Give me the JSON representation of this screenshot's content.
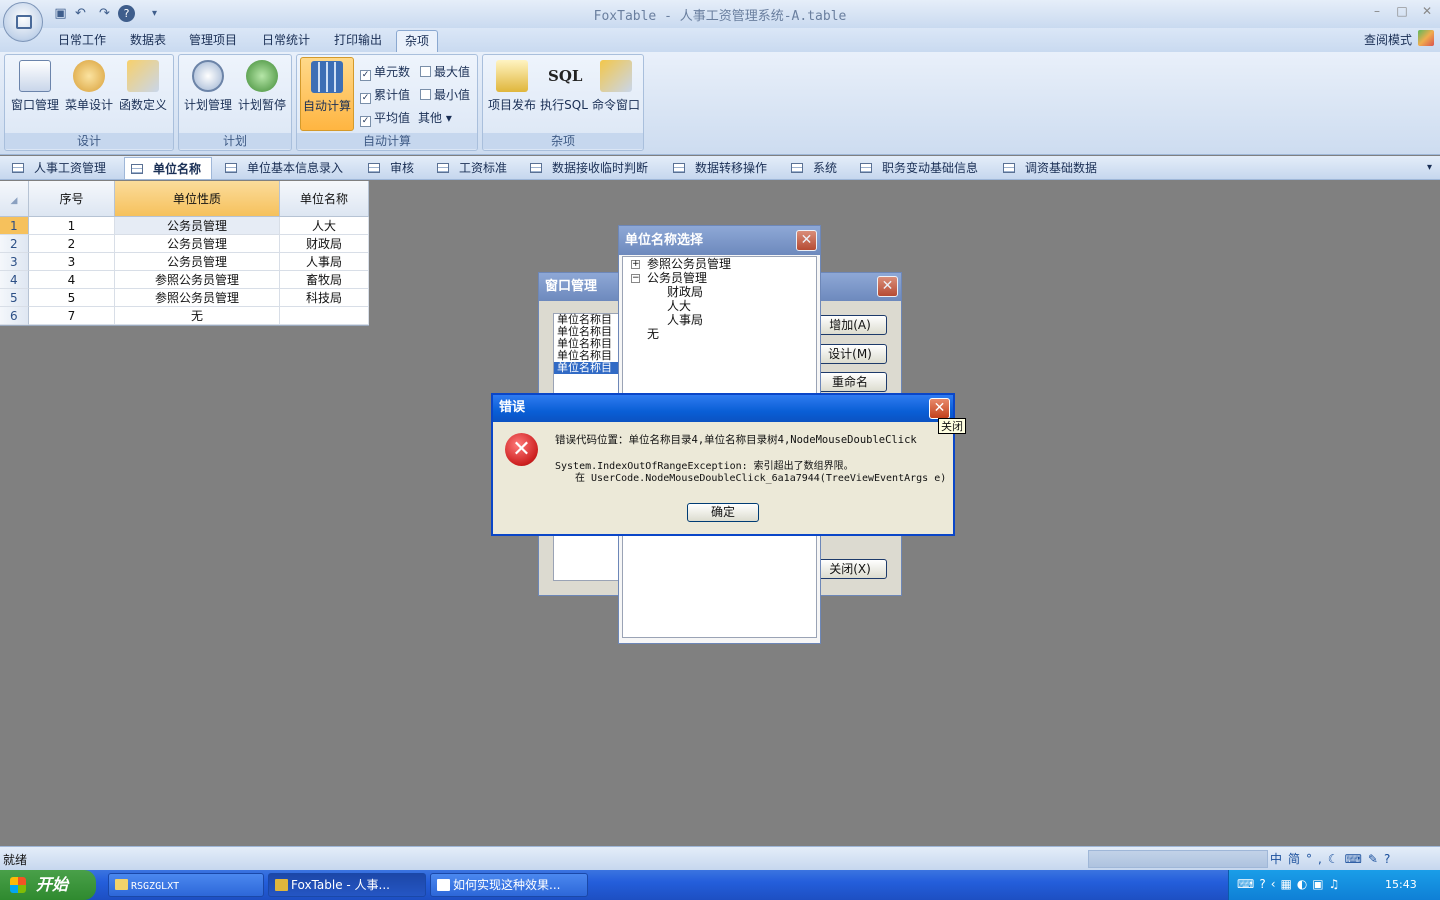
{
  "window": {
    "title": "FoxTable - 人事工资管理系统-A.table"
  },
  "menu": {
    "tabs": [
      "日常工作",
      "数据表",
      "管理项目",
      "日常统计",
      "打印输出",
      "杂项"
    ],
    "active": "杂项",
    "view_mode": "查阅模式"
  },
  "ribbon": {
    "design": {
      "label": "设计",
      "buttons": [
        "窗口管理",
        "菜单设计",
        "函数定义"
      ]
    },
    "plan": {
      "label": "计划",
      "buttons": [
        "计划管理",
        "计划暂停"
      ]
    },
    "autocalc": {
      "label": "自动计算",
      "button": "自动计算",
      "checks": [
        {
          "label": "单元数",
          "checked": true
        },
        {
          "label": "最大值",
          "checked": false
        },
        {
          "label": "累计值",
          "checked": true
        },
        {
          "label": "最小值",
          "checked": false
        },
        {
          "label": "平均值",
          "checked": true
        }
      ],
      "other": "其他"
    },
    "misc": {
      "label": "杂项",
      "buttons": [
        "项目发布",
        "执行SQL",
        "命令窗口"
      ],
      "sql_icon_text": "SQL"
    }
  },
  "sheet_tabs": [
    "人事工资管理",
    "单位名称",
    "单位基本信息录入",
    "审核",
    "工资标准",
    "数据接收临时判断",
    "数据转移操作",
    "系统",
    "职务变动基础信息",
    "调资基础数据"
  ],
  "grid": {
    "columns": [
      "序号",
      "单位性质",
      "单位名称"
    ],
    "rows": [
      {
        "n": "1",
        "seq": "1",
        "type": "公务员管理",
        "name": "人大"
      },
      {
        "n": "2",
        "seq": "2",
        "type": "公务员管理",
        "name": "财政局"
      },
      {
        "n": "3",
        "seq": "3",
        "type": "公务员管理",
        "name": "人事局"
      },
      {
        "n": "4",
        "seq": "4",
        "type": "参照公务员管理",
        "name": "畜牧局"
      },
      {
        "n": "5",
        "seq": "5",
        "type": "参照公务员管理",
        "name": "科技局"
      },
      {
        "n": "6",
        "seq": "7",
        "type": "无",
        "name": ""
      }
    ]
  },
  "window_mgr": {
    "title": "窗口管理",
    "list": [
      "单位名称目",
      "单位名称目",
      "单位名称目",
      "单位名称目",
      "单位名称目"
    ],
    "buttons": {
      "add": "增加(A)",
      "design": "设计(M)",
      "rename": "重命名",
      "close": "关闭(X)"
    }
  },
  "tree_dialog": {
    "title": "单位名称选择",
    "nodes": [
      {
        "label": "参照公务员管理",
        "expander": "+"
      },
      {
        "label": "公务员管理",
        "expander": "−"
      },
      {
        "label": "财政局"
      },
      {
        "label": "人大"
      },
      {
        "label": "人事局"
      },
      {
        "label": "无"
      }
    ]
  },
  "error": {
    "title": "错误",
    "line1": "错误代码位置：单位名称目录4,单位名称目录树4,NodeMouseDoubleClick",
    "line2": "System.IndexOutOfRangeException: 索引超出了数组界限。",
    "line3": "在 UserCode.NodeMouseDoubleClick_6a1a7944(TreeViewEventArgs e)",
    "ok": "确定",
    "tooltip": "关闭"
  },
  "status": {
    "text": "就绪"
  },
  "taskbar": {
    "start": "开始",
    "tasks": [
      "RSGZGLXT",
      "FoxTable - 人事...",
      "如何实现这种效果..."
    ],
    "clock": "15:43"
  },
  "colors": {
    "title_active": "#0a5fd6",
    "error_red": "#cc1f1f",
    "ribbon_active": "#ffb541",
    "taskbar": "#245edb"
  }
}
